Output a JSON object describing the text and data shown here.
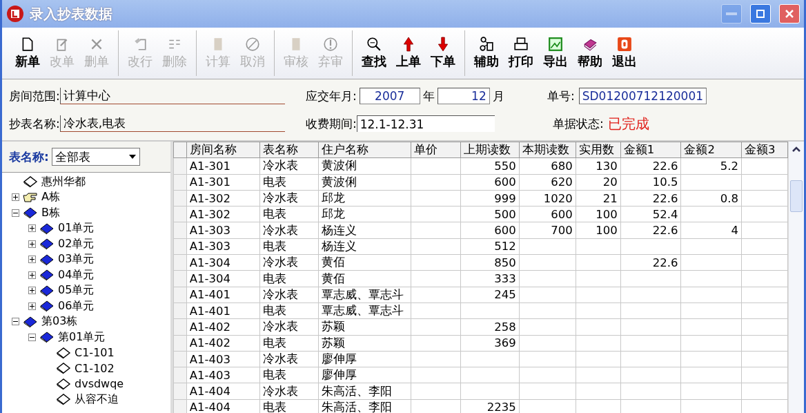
{
  "window": {
    "title": "录入抄表数据",
    "controls": [
      {
        "kind": "minimize",
        "disabled": true
      },
      {
        "kind": "maximize",
        "disabled": false
      },
      {
        "kind": "close",
        "disabled": false
      }
    ]
  },
  "toolbar": [
    {
      "buttons": [
        {
          "label": "新单",
          "disabled": false
        },
        {
          "label": "改单",
          "disabled": true
        },
        {
          "label": "删单",
          "disabled": true
        }
      ]
    },
    {
      "buttons": [
        {
          "label": "改行",
          "disabled": true
        },
        {
          "label": "删除",
          "disabled": true
        }
      ]
    },
    {
      "buttons": [
        {
          "label": "计算",
          "disabled": true
        },
        {
          "label": "取消",
          "disabled": true
        }
      ]
    },
    {
      "buttons": [
        {
          "label": "审核",
          "disabled": true
        },
        {
          "label": "弃审",
          "disabled": true
        }
      ]
    },
    {
      "buttons": [
        {
          "label": "查找",
          "disabled": false
        },
        {
          "label": "上单",
          "disabled": false
        },
        {
          "label": "下单",
          "disabled": false
        }
      ]
    },
    {
      "buttons": [
        {
          "label": "辅助",
          "disabled": false
        },
        {
          "label": "打印",
          "disabled": false
        },
        {
          "label": "导出",
          "disabled": false
        },
        {
          "label": "帮助",
          "disabled": false
        },
        {
          "label": "退出",
          "disabled": false
        }
      ]
    }
  ],
  "form": {
    "room_range": {
      "label": "房间范围:",
      "value": "计算中心"
    },
    "meter_names": {
      "label": "抄表名称:",
      "value": "冷水表,电表"
    },
    "period": {
      "label": "应交年月:",
      "year": "2007",
      "year_unit": "年",
      "month": "12",
      "month_unit": "月"
    },
    "charge_period": {
      "label": "收费期间:",
      "value": "12.1-12.31"
    },
    "doc_no": {
      "label": "单号:",
      "value": "SD01200712120001"
    },
    "doc_status": {
      "label": "单据状态:",
      "value": "已完成"
    }
  },
  "sidebar": {
    "filter": {
      "label": "表名称:",
      "value": "全部表"
    },
    "tree": [
      {
        "label": "惠州华都",
        "kind": "leaf"
      },
      {
        "label": "A栋",
        "kind": "pointer",
        "expanded": false
      },
      {
        "label": "B栋",
        "kind": "group",
        "expanded": true,
        "children": [
          {
            "label": "01单元",
            "kind": "group",
            "expanded": false
          },
          {
            "label": "02单元",
            "kind": "group",
            "expanded": false
          },
          {
            "label": "03单元",
            "kind": "group",
            "expanded": false
          },
          {
            "label": "04单元",
            "kind": "group",
            "expanded": false
          },
          {
            "label": "05单元",
            "kind": "group",
            "expanded": false
          },
          {
            "label": "06单元",
            "kind": "group",
            "expanded": false
          }
        ]
      },
      {
        "label": "第03栋",
        "kind": "group",
        "expanded": true,
        "children": [
          {
            "label": "第01单元",
            "kind": "group",
            "expanded": true,
            "children": [
              {
                "label": "C1-101",
                "kind": "leaf"
              },
              {
                "label": "C1-102",
                "kind": "leaf"
              },
              {
                "label": "dvsdwqe",
                "kind": "leaf"
              },
              {
                "label": "从容不迫",
                "kind": "leaf"
              }
            ]
          }
        ]
      }
    ]
  },
  "table": {
    "columns": [
      "房间名称",
      "表名称",
      "住户名称",
      "单价",
      "上期读数",
      "本期读数",
      "实用数",
      "金额1",
      "金额2",
      "金额3"
    ],
    "rows": [
      [
        "A1-301",
        "冷水表",
        "黄波俐",
        "",
        "550",
        "680",
        "130",
        "22.6",
        "5.2",
        ""
      ],
      [
        "A1-301",
        "电表",
        "黄波俐",
        "",
        "600",
        "620",
        "20",
        "10.5",
        "",
        ""
      ],
      [
        "A1-302",
        "冷水表",
        "邱龙",
        "",
        "999",
        "1020",
        "21",
        "22.6",
        "0.8",
        ""
      ],
      [
        "A1-302",
        "电表",
        "邱龙",
        "",
        "500",
        "600",
        "100",
        "52.4",
        "",
        ""
      ],
      [
        "A1-303",
        "冷水表",
        "杨连义",
        "",
        "600",
        "700",
        "100",
        "22.6",
        "4",
        ""
      ],
      [
        "A1-303",
        "电表",
        "杨连义",
        "",
        "512",
        "",
        "",
        "",
        "",
        ""
      ],
      [
        "A1-304",
        "冷水表",
        "黄佰",
        "",
        "850",
        "",
        "",
        "22.6",
        "",
        ""
      ],
      [
        "A1-304",
        "电表",
        "黄佰",
        "",
        "333",
        "",
        "",
        "",
        "",
        ""
      ],
      [
        "A1-401",
        "冷水表",
        "覃志威、覃志斗",
        "",
        "245",
        "",
        "",
        "",
        "",
        ""
      ],
      [
        "A1-401",
        "电表",
        "覃志威、覃志斗",
        "",
        "",
        "",
        "",
        "",
        "",
        ""
      ],
      [
        "A1-402",
        "冷水表",
        "苏颖",
        "",
        "258",
        "",
        "",
        "",
        "",
        ""
      ],
      [
        "A1-402",
        "电表",
        "苏颖",
        "",
        "369",
        "",
        "",
        "",
        "",
        ""
      ],
      [
        "A1-403",
        "冷水表",
        "廖伸厚",
        "",
        "",
        "",
        "",
        "",
        "",
        ""
      ],
      [
        "A1-403",
        "电表",
        "廖伸厚",
        "",
        "",
        "",
        "",
        "",
        "",
        ""
      ],
      [
        "A1-404",
        "冷水表",
        "朱高活、李阳",
        "",
        "",
        "",
        "",
        "",
        "",
        ""
      ],
      [
        "A1-404",
        "电表",
        "朱高活、李阳",
        "",
        "2235",
        "",
        "",
        "",
        "",
        ""
      ]
    ]
  }
}
